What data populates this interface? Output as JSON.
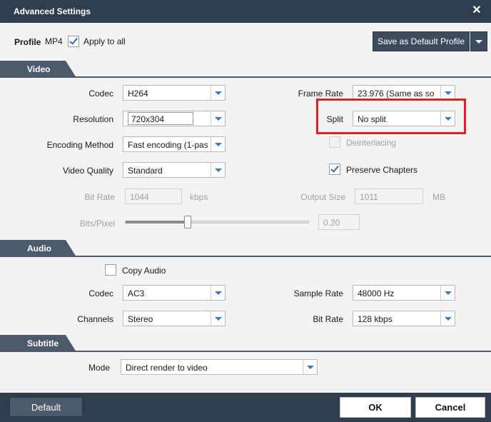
{
  "window": {
    "title": "Advanced Settings",
    "close_glyph": "✕"
  },
  "profile": {
    "label": "Profile",
    "value": "MP4",
    "apply_all_label": "Apply to all",
    "apply_all_checked": true,
    "save_default_label": "Save as Default Profile"
  },
  "sections": {
    "video": "Video",
    "audio": "Audio",
    "subtitle": "Subtitle"
  },
  "video": {
    "codec_label": "Codec",
    "codec_value": "H264",
    "frame_rate_label": "Frame Rate",
    "frame_rate_value": "23.976 (Same as so",
    "resolution_label": "Resolution",
    "resolution_value": "720x304",
    "split_label": "Split",
    "split_value": "No split",
    "encoding_label": "Encoding Method",
    "encoding_value": "Fast encoding (1-pas",
    "deinterlacing_label": "Deinterlacing",
    "deinterlacing_checked": false,
    "quality_label": "Video Quality",
    "quality_value": "Standard",
    "preserve_chapters_label": "Preserve Chapters",
    "preserve_chapters_checked": true,
    "bitrate_label": "Bit Rate",
    "bitrate_value": "1044",
    "bitrate_unit": "kbps",
    "output_size_label": "Output Size",
    "output_size_value": "1011",
    "output_size_unit": "MB",
    "bits_pixel_label": "Bits/Pixel",
    "bits_pixel_value": "0.20",
    "bits_pixel_slider_fraction": 0.34
  },
  "audio": {
    "copy_audio_label": "Copy Audio",
    "copy_audio_checked": false,
    "codec_label": "Codec",
    "codec_value": "AC3",
    "sample_rate_label": "Sample Rate",
    "sample_rate_value": "48000 Hz",
    "channels_label": "Channels",
    "channels_value": "Stereo",
    "bitrate_label": "Bit Rate",
    "bitrate_value": "128 kbps"
  },
  "subtitle": {
    "mode_label": "Mode",
    "mode_value": "Direct render to video"
  },
  "footer": {
    "default_label": "Default",
    "ok_label": "OK",
    "cancel_label": "Cancel"
  },
  "colors": {
    "titlebar": "#2f3d4f",
    "section": "#4d5a6c",
    "highlight": "#e3202b",
    "check": "#2d6fb8"
  }
}
